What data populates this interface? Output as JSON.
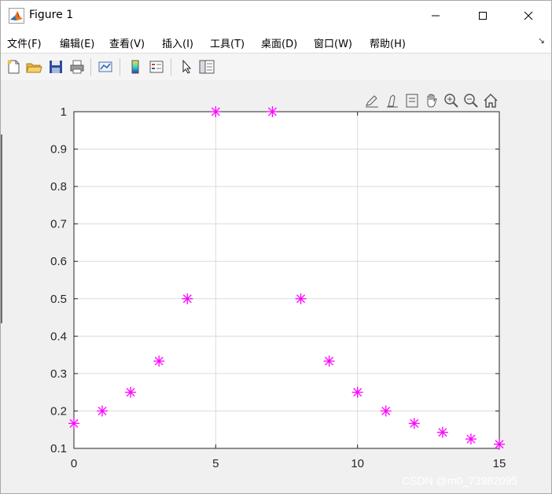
{
  "window": {
    "title": "Figure 1"
  },
  "menu": {
    "items": [
      {
        "label": "文件(F)"
      },
      {
        "label": "编辑(E)"
      },
      {
        "label": "查看(V)"
      },
      {
        "label": "插入(I)"
      },
      {
        "label": "工具(T)"
      },
      {
        "label": "桌面(D)"
      },
      {
        "label": "窗口(W)"
      },
      {
        "label": "帮助(H)"
      }
    ]
  },
  "toolbar": {
    "icons": [
      "new-figure-icon",
      "open-file-icon",
      "save-icon",
      "print-icon",
      "link-plot-icon",
      "colorbar-icon",
      "legend-icon",
      "edit-pointer-icon",
      "property-inspector-icon"
    ]
  },
  "axes_toolbar": {
    "icons": [
      "brush-icon",
      "data-tips-icon",
      "rotate-icon",
      "pan-icon",
      "zoom-in-icon",
      "zoom-out-icon",
      "home-icon"
    ]
  },
  "chart_data": {
    "type": "scatter",
    "marker": "asterisk",
    "color": "#ff00ff",
    "x": [
      0,
      1,
      2,
      3,
      4,
      5,
      7,
      8,
      9,
      10,
      11,
      12,
      13,
      14,
      15
    ],
    "y": [
      0.1667,
      0.2,
      0.25,
      0.3333,
      0.5,
      1,
      1,
      0.5,
      0.3333,
      0.25,
      0.2,
      0.1667,
      0.1429,
      0.125,
      0.1111
    ],
    "xlim": [
      0,
      15
    ],
    "ylim": [
      0.1,
      1
    ],
    "xticks": [
      "0",
      "5",
      "10",
      "15"
    ],
    "yticks": [
      "0.1",
      "0.2",
      "0.3",
      "0.4",
      "0.5",
      "0.6",
      "0.7",
      "0.8",
      "0.9",
      "1"
    ],
    "grid": true
  },
  "watermark": "CSDN @m0_73982095"
}
